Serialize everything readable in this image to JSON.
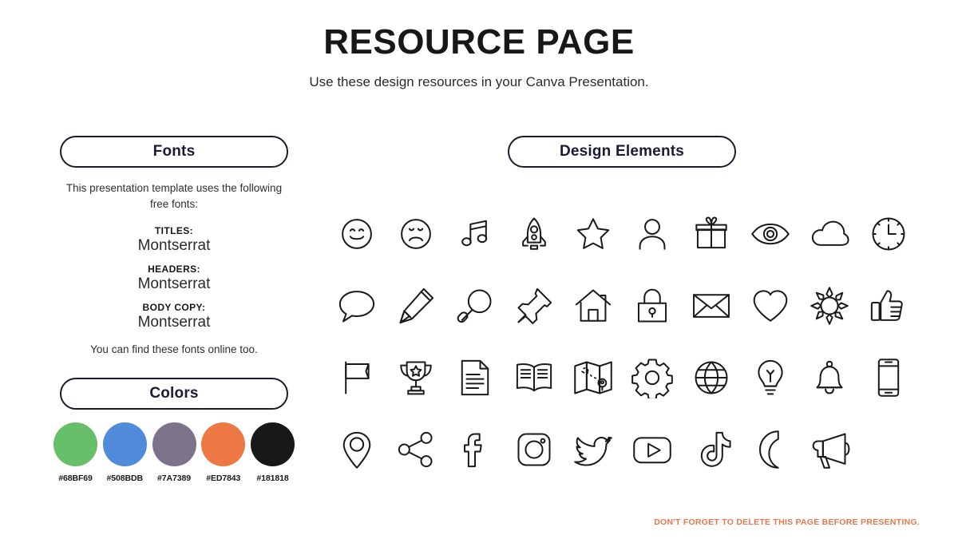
{
  "header": {
    "title": "RESOURCE PAGE",
    "subtitle": "Use these design resources in your Canva Presentation."
  },
  "fonts_section": {
    "pill_label": "Fonts",
    "intro": "This presentation template uses the following free fonts:",
    "entries": [
      {
        "role": "TITLES:",
        "font": "Montserrat"
      },
      {
        "role": "HEADERS:",
        "font": "Montserrat"
      },
      {
        "role": "BODY COPY:",
        "font": "Montserrat"
      }
    ],
    "outro": "You can find these fonts online too."
  },
  "colors_section": {
    "pill_label": "Colors",
    "swatches": [
      {
        "hex": "#68BF69",
        "label": "#68BF69"
      },
      {
        "hex": "#508BDB",
        "label": "#508BDB"
      },
      {
        "hex": "#7A7389",
        "label": "#7A7389"
      },
      {
        "hex": "#ED7843",
        "label": "#ED7843"
      },
      {
        "hex": "#181818",
        "label": "#181818"
      }
    ]
  },
  "design_section": {
    "pill_label": "Design Elements",
    "icons": [
      "smiley-face-icon",
      "sad-face-icon",
      "music-note-icon",
      "rocket-icon",
      "star-icon",
      "person-icon",
      "gift-icon",
      "eye-icon",
      "cloud-icon",
      "clock-icon",
      "speech-bubble-icon",
      "pencil-icon",
      "magnifying-glass-icon",
      "pushpin-icon",
      "house-icon",
      "lock-icon",
      "envelope-icon",
      "heart-icon",
      "sun-icon",
      "thumbs-up-icon",
      "flag-icon",
      "trophy-icon",
      "document-icon",
      "open-book-icon",
      "map-icon",
      "gear-icon",
      "globe-icon",
      "lightbulb-icon",
      "bell-icon",
      "smartphone-icon",
      "location-pin-icon",
      "share-icon",
      "facebook-icon",
      "instagram-icon",
      "twitter-icon",
      "youtube-icon",
      "tiktok-icon",
      "moon-icon",
      "megaphone-icon"
    ]
  },
  "footer": {
    "note": "DON'T FORGET TO DELETE THIS PAGE BEFORE PRESENTING.",
    "note_color": "#E5784F"
  }
}
